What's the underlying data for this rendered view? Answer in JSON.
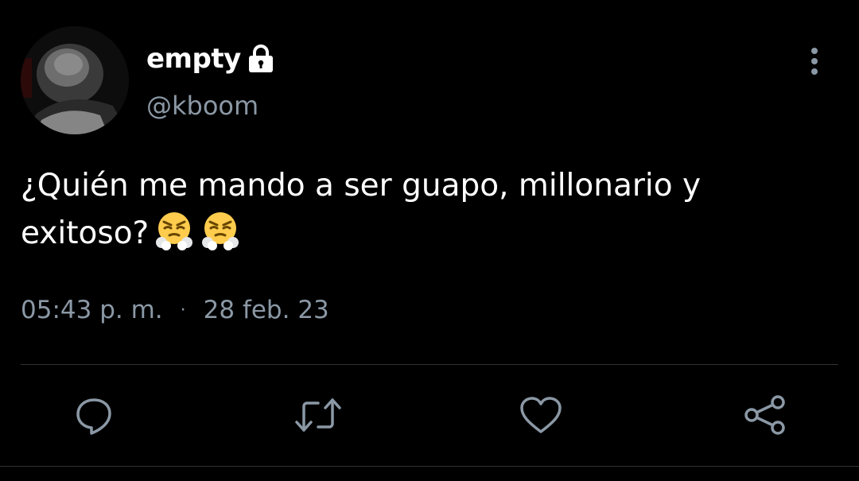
{
  "user": {
    "display_name": "empty",
    "handle": "@kboom",
    "protected_icon": "lock-icon",
    "avatar": "profile-photo"
  },
  "tweet": {
    "text_line1": "¿Quién me mando a ser guapo, millonario y",
    "text_line2": "exitoso?",
    "emojis": [
      "face-with-steam-from-nose",
      "face-with-steam-from-nose"
    ]
  },
  "meta": {
    "time": "05:43 p. m.",
    "separator": "·",
    "date": "28 feb. 23"
  },
  "actions": [
    {
      "name": "reply",
      "icon": "comment-icon"
    },
    {
      "name": "retweet",
      "icon": "retweet-icon"
    },
    {
      "name": "like",
      "icon": "heart-icon"
    },
    {
      "name": "share",
      "icon": "share-icon"
    }
  ],
  "colors": {
    "background": "#000000",
    "text_primary": "#ffffff",
    "text_secondary": "#8b98a5",
    "divider": "#2f3336",
    "emoji_face": "#ffcc4d"
  }
}
